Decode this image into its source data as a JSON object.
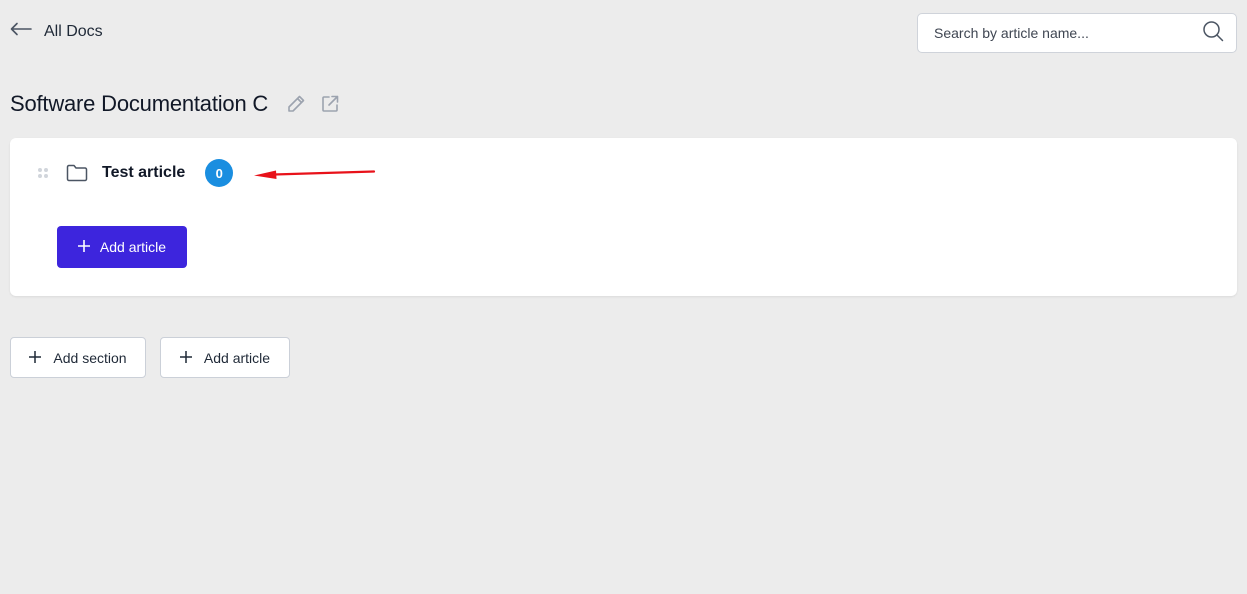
{
  "nav": {
    "back_icon": "arrow-left-icon",
    "back_label": "All Docs"
  },
  "search": {
    "placeholder": "Search by article name...",
    "value": "",
    "icon": "search-icon"
  },
  "doc": {
    "title": "Software Documentation C",
    "edit_icon": "pencil-icon",
    "open_icon": "external-link-icon"
  },
  "sections": [
    {
      "name": "Test article",
      "icon": "folder-icon",
      "article_count": "0",
      "add_article_label": "Add article"
    }
  ],
  "footer_actions": {
    "add_section_label": "Add section",
    "add_article_label": "Add article"
  },
  "colors": {
    "primary": "#3d25dd",
    "badge": "#1a8ee0",
    "annotation": "#e8121a",
    "background": "#ececec"
  }
}
